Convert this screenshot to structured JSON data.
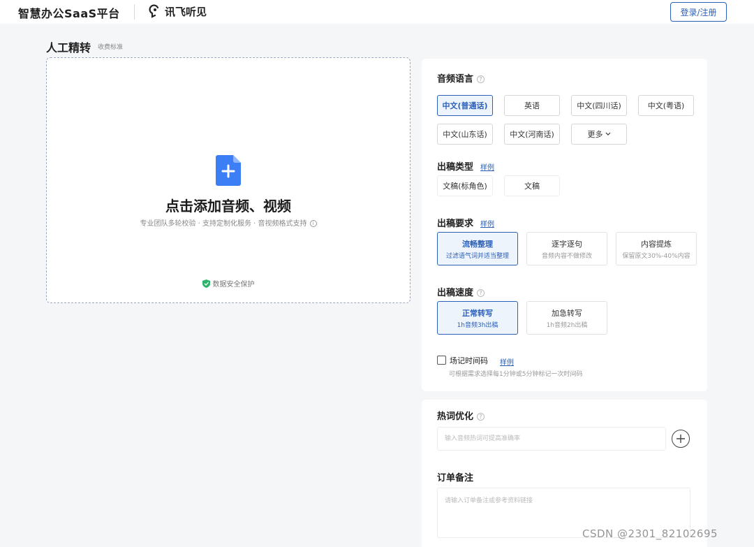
{
  "header": {
    "brand": "智慧办公SaaS平台",
    "partner": "讯飞听见",
    "login": "登录/注册"
  },
  "page": {
    "title": "人工精转",
    "price_link": "收费标准"
  },
  "upload": {
    "title": "点击添加音频、视频",
    "desc": "专业团队多轮校验 · 支持定制化服务 · 音视频格式支持",
    "security": "数据安全保护"
  },
  "settings": {
    "language": {
      "title": "音频语言",
      "options": [
        "中文(普通话)",
        "英语",
        "中文(四川话)",
        "中文(粤语)",
        "中文(山东话)",
        "中文(河南话)",
        "更多"
      ],
      "selected": "中文(普通话)"
    },
    "draft_type": {
      "title": "出稿类型",
      "sample": "样例",
      "options": [
        "文稿(标角色)",
        "文稿"
      ]
    },
    "draft_requirement": {
      "title": "出稿要求",
      "sample": "样例",
      "options": [
        {
          "title": "流畅整理",
          "sub": "过滤语气词并适当整理"
        },
        {
          "title": "逐字逐句",
          "sub": "音频内容不做修改"
        },
        {
          "title": "内容提炼",
          "sub": "保留原文30%-40%内容"
        }
      ],
      "selected": "流畅整理"
    },
    "draft_speed": {
      "title": "出稿速度",
      "options": [
        {
          "title": "正常转写",
          "sub": "1h音频3h出稿"
        },
        {
          "title": "加急转写",
          "sub": "1h音频2h出稿"
        }
      ],
      "selected": "正常转写"
    },
    "timecode": {
      "label": "场记时间码",
      "sample": "样例",
      "desc": "可根据需求选择每1分钟或5分钟标记一次时间码",
      "checked": false
    },
    "hotwords": {
      "title": "热词优化",
      "placeholder": "输入音频热词可提高准确率"
    },
    "note": {
      "title": "订单备注",
      "placeholder": "请输入订单备注或参考资料链接"
    }
  },
  "watermark": "CSDN @2301_82102695",
  "colors": {
    "accent": "#2b5fb8",
    "selected_bg": "#eef4fc",
    "file_icon": "#3b7ef6",
    "shield": "#2fb36b"
  }
}
